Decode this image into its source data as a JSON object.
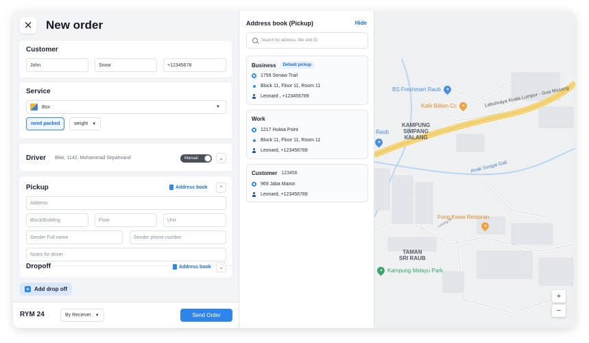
{
  "header": {
    "title": "New order"
  },
  "customer": {
    "title": "Customer",
    "first_name": "John",
    "last_name": "Snow",
    "phone": "+12345678"
  },
  "service": {
    "title": "Service",
    "selected": "Box",
    "chips": {
      "need_packed": "need packed",
      "weight": "weight"
    }
  },
  "driver": {
    "title": "Driver",
    "detail": "Bike, 1142, Mohammad Sepahvand",
    "toggle_label": "Manual"
  },
  "pickup": {
    "title": "Pickup",
    "address_book_label": "Address book",
    "placeholders": {
      "address": "Address",
      "block": "Block/Building",
      "floor": "Floor",
      "unit": "Unit",
      "sender_name": "Sender Full name",
      "sender_phone": "Sender phone number",
      "notes": "Notes for driver"
    }
  },
  "dropoff": {
    "title": "Dropoff",
    "address_book_label": "Address book"
  },
  "add_dropoff_label": "Add drop off",
  "footer": {
    "price": "RYM 24",
    "payer": "By Reciever",
    "send_label": "Send Order"
  },
  "address_book": {
    "title": "Address book (Pickup)",
    "hide_label": "Hide",
    "search_placeholder": "Search by address, title and ID",
    "entries": [
      {
        "title": "Business",
        "badge": "Default pickup",
        "address": "1759 Senaw Trail",
        "detail": "Block 11, Floor 11, Room 11",
        "contact": "Leonard , +123456789"
      },
      {
        "title": "Work",
        "address": "1217 Huiwa Point",
        "detail": "Block 11, Floor 11, Room 11",
        "contact": "Leonard, +123456789"
      },
      {
        "title": "Customer",
        "id": "123456",
        "address": "969 Jaba Manor",
        "contact": "Leonard, +123456789"
      }
    ]
  },
  "map": {
    "places": {
      "freshmart": "BS Freshmart Raub",
      "kafe": "Kafe Billion Cc",
      "kampung_simpang": "KAMPUNG\nSIMPANG\nKALANG",
      "raub": "Raub",
      "highway": "Lebuhraya Kuala Lumpur - Gua Musang",
      "river": "Anak Sungai Gali",
      "fong_kwee": "Fong Kwee Restoran",
      "taman": "TAMAN\nSRI RAUB",
      "park": "Kampung Melayu Park",
      "lorong14": "Lorong 14"
    },
    "zoom_in": "+",
    "zoom_out": "−"
  },
  "colors": {
    "accent": "#2f86e8",
    "highway": "#f5d57a",
    "poi_blue": "#4a8fe0",
    "poi_orange": "#f0a23c",
    "poi_green": "#3aa66a"
  }
}
